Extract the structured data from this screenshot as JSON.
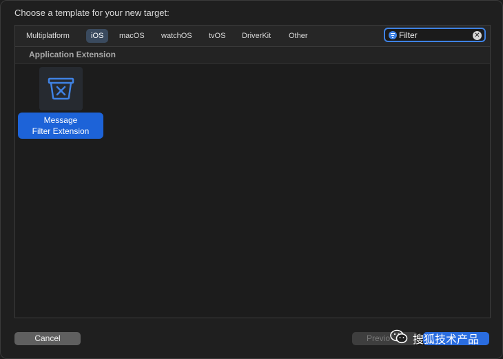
{
  "dialog": {
    "title": "Choose a template for your new target:"
  },
  "tabs": [
    {
      "label": "Multiplatform",
      "active": false
    },
    {
      "label": "iOS",
      "active": true
    },
    {
      "label": "macOS",
      "active": false
    },
    {
      "label": "watchOS",
      "active": false
    },
    {
      "label": "tvOS",
      "active": false
    },
    {
      "label": "DriverKit",
      "active": false
    },
    {
      "label": "Other",
      "active": false
    }
  ],
  "search": {
    "value": "Filter",
    "icon": "filter-icon",
    "clear_icon": "clear-icon"
  },
  "section": {
    "title": "Application Extension"
  },
  "templates": [
    {
      "label_line1": "Message",
      "label_line2": "Filter Extension",
      "icon": "message-filter-icon",
      "selected": true
    }
  ],
  "footer": {
    "cancel_label": "Cancel",
    "previous_label": "Previo",
    "watermark_text": "搜狐技术产品"
  },
  "colors": {
    "accent": "#2a6de0",
    "selection": "#1d63d8",
    "icon_blue": "#3f82e4"
  }
}
